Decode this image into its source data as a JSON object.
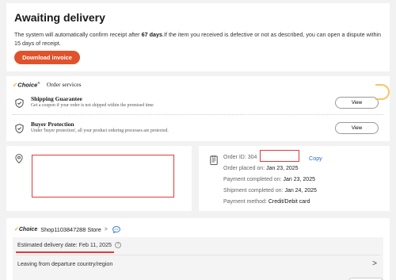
{
  "awaiting": {
    "title": "Awaiting delivery",
    "desc_prefix": "The system will automatically confirm receipt after ",
    "days": "67 days",
    "desc_suffix": ".If the item you received is defective or not as described, you can open a dispute within 15 days of receipt.",
    "download_label": "Download invoice"
  },
  "services": {
    "choice_label": "Choice",
    "title": "Order services",
    "shipping": {
      "title": "Shipping Guarantee",
      "subtitle": "Get a coupon if your order is not shipped within the promised time",
      "button": "View"
    },
    "buyer": {
      "title": "Buyer Protection",
      "subtitle": "Under 'buyer protection', all your product ordering processes are protected.",
      "button": "View"
    }
  },
  "order": {
    "id_label": "Order ID: 304",
    "copy_label": "Copy",
    "placed_label": "Order placed on: ",
    "placed_value": "Jan 23, 2025",
    "payment_label": "Payment completed on: ",
    "payment_value": "Jan 23, 2025",
    "shipment_label": "Shipment completed on: ",
    "shipment_value": "Jan 24, 2025",
    "method_label": "Payment method: ",
    "method_value": "Credit/Debit card"
  },
  "shop": {
    "choice_label": "Choice",
    "name": "Shop1103847288 Store",
    "chevron": ">",
    "estimated_delivery": "Estimated delivery date: Feb 11, 2025",
    "info_glyph": "?",
    "leaving": "Leaving from departure country/region",
    "leaving_chevron": ">"
  },
  "colors": {
    "accent": "#e0522b",
    "redaction": "#e03b3b",
    "link": "#2e6bd6",
    "choice_check": "#f0a52a"
  },
  "icons": [
    "shield-check-icon",
    "location-pin-icon",
    "document-icon",
    "chat-bubble-icon",
    "info-icon",
    "chevron-right-icon"
  ]
}
